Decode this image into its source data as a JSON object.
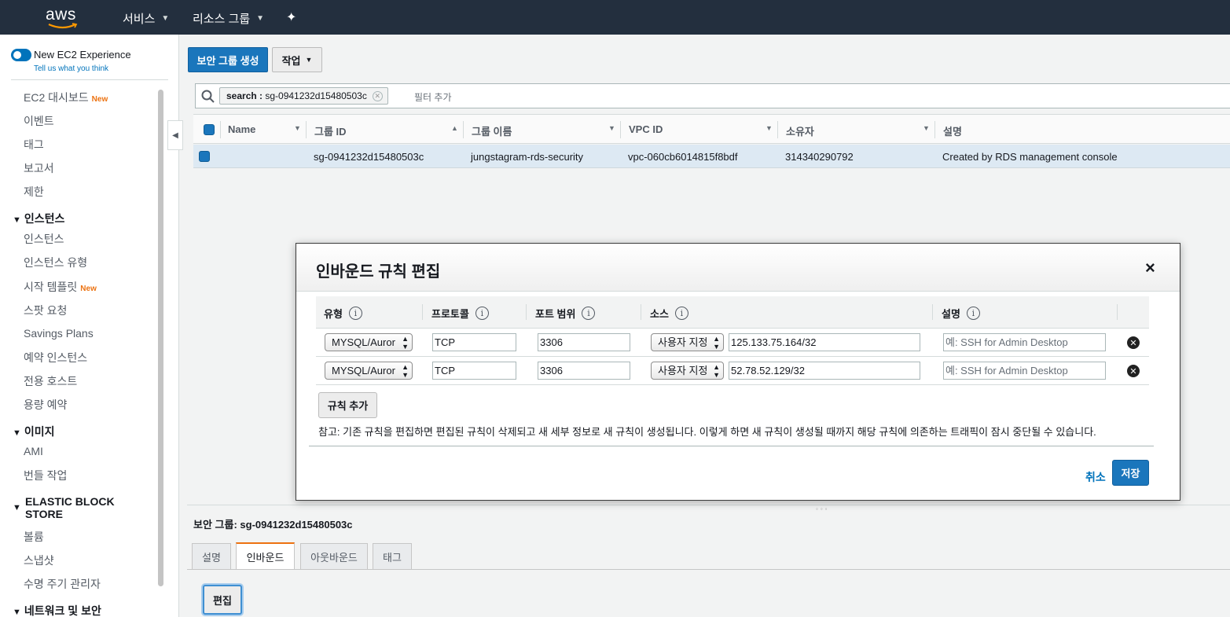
{
  "topnav": {
    "logo": "aws",
    "services_label": "서비스",
    "resource_groups_label": "리소스 그룹",
    "pin_icon": "pin-icon"
  },
  "sidebar": {
    "toggle_label": "New EC2 Experience",
    "tell_us": "Tell us what you think",
    "new_badge": "New",
    "items": [
      {
        "label": "EC2 대시보드",
        "new": true
      },
      {
        "label": "이벤트"
      },
      {
        "label": "태그"
      },
      {
        "label": "보고서"
      },
      {
        "label": "제한"
      }
    ],
    "sections": [
      {
        "title": "인스턴스",
        "items": [
          "인스턴스",
          "인스턴스 유형",
          "시작 템플릿",
          "스팟 요청",
          "Savings Plans",
          "예약 인스턴스",
          "전용 호스트",
          "용량 예약"
        ]
      },
      {
        "title": "이미지",
        "items": [
          "AMI",
          "번들 작업"
        ]
      },
      {
        "title_line1": "ELASTIC BLOCK",
        "title_line2": "STORE",
        "items": [
          "볼륨",
          "스냅샷",
          "수명 주기 관리자"
        ]
      },
      {
        "title": "네트워크 및 보안"
      }
    ]
  },
  "toolbar": {
    "create_sg": "보안 그룹 생성",
    "actions": "작업"
  },
  "filter": {
    "chip_key": "search :",
    "chip_value": " sg-0941232d15480503c",
    "add_filter": "필터 추가"
  },
  "table": {
    "headers": [
      "Name",
      "그룹 ID",
      "그룹 이름",
      "VPC ID",
      "소유자",
      "설명"
    ],
    "rows": [
      {
        "name": "",
        "group_id": "sg-0941232d15480503c",
        "group_name": "jungstagram-rds-security",
        "vpc_id": "vpc-060cb6014815f8bdf",
        "owner": "314340290792",
        "description": "Created by RDS management console"
      }
    ]
  },
  "bottom": {
    "sg_title": "보안 그룹: sg-0941232d15480503c",
    "tabs": [
      "설명",
      "인바운드",
      "아웃바운드",
      "태그"
    ],
    "active_tab": "인바운드",
    "edit": "편집"
  },
  "modal": {
    "title": "인바운드 규칙 편집",
    "close": "×",
    "headers": [
      "유형",
      "프로토콜",
      "포트 범위",
      "소스",
      "설명"
    ],
    "info_glyph": "i",
    "rules": [
      {
        "type": "MYSQL/Auror",
        "protocol": "TCP",
        "port": "3306",
        "source_type": "사용자 지정",
        "source": "125.133.75.164/32",
        "description_placeholder": "예: SSH for Admin Desktop"
      },
      {
        "type": "MYSQL/Auror",
        "protocol": "TCP",
        "port": "3306",
        "source_type": "사용자 지정",
        "source": "52.78.52.129/32",
        "description_placeholder": "예: SSH for Admin Desktop"
      }
    ],
    "add_rule": "규칙 추가",
    "note": "참고: 기존 규칙을 편집하면 편집된 규칙이 삭제되고 새 세부 정보로 새 규칙이 생성됩니다. 이렇게 하면 새 규칙이 생성될 때까지 해당 규칙에 의존하는 트래픽이 잠시 중단될 수 있습니다.",
    "cancel": "취소",
    "save": "저장"
  },
  "colors": {
    "nav_bg": "#232f3e",
    "primary": "#1a76bc",
    "accent_new": "#ec7211",
    "link": "#0073bb"
  }
}
